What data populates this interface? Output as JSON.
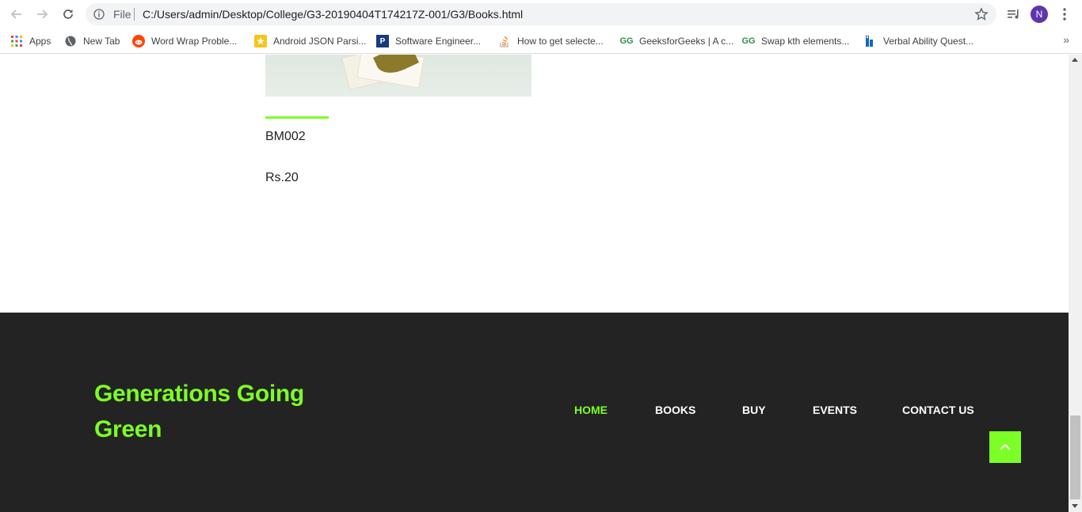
{
  "browser": {
    "omnibox": {
      "scheme_label": "File",
      "url": "C:/Users/admin/Desktop/College/G3-20190404T174217Z-001/G3/Books.html"
    },
    "avatar_letter": "N",
    "bookmarks": [
      {
        "label": "Apps",
        "icon": "apps-grid-icon"
      },
      {
        "label": "New Tab",
        "icon": "globe-icon"
      },
      {
        "label": "Word Wrap Proble...",
        "icon": "reddit-icon"
      },
      {
        "label": "Android JSON Parsi...",
        "icon": "android-icon"
      },
      {
        "label": "Software Engineer...",
        "icon": "p-icon"
      },
      {
        "label": "How to get selecte...",
        "icon": "stackoverflow-icon"
      },
      {
        "label": "GeeksforGeeks | A c...",
        "icon": "gfg-icon"
      },
      {
        "label": "Swap kth elements...",
        "icon": "gfg-icon"
      },
      {
        "label": "Verbal Ability Quest...",
        "icon": "indiabix-icon"
      }
    ],
    "more_bookmarks": "»"
  },
  "product": {
    "code": "BM002",
    "price": "Rs.20"
  },
  "footer": {
    "brand": "Generations Going Green",
    "nav": [
      {
        "label": "HOME",
        "active": true
      },
      {
        "label": "BOOKS",
        "active": false
      },
      {
        "label": "BUY",
        "active": false
      },
      {
        "label": "EVENTS",
        "active": false
      },
      {
        "label": "CONTACT US",
        "active": false
      }
    ]
  },
  "colors": {
    "accent": "#7cff26",
    "footer_bg": "#232323"
  }
}
